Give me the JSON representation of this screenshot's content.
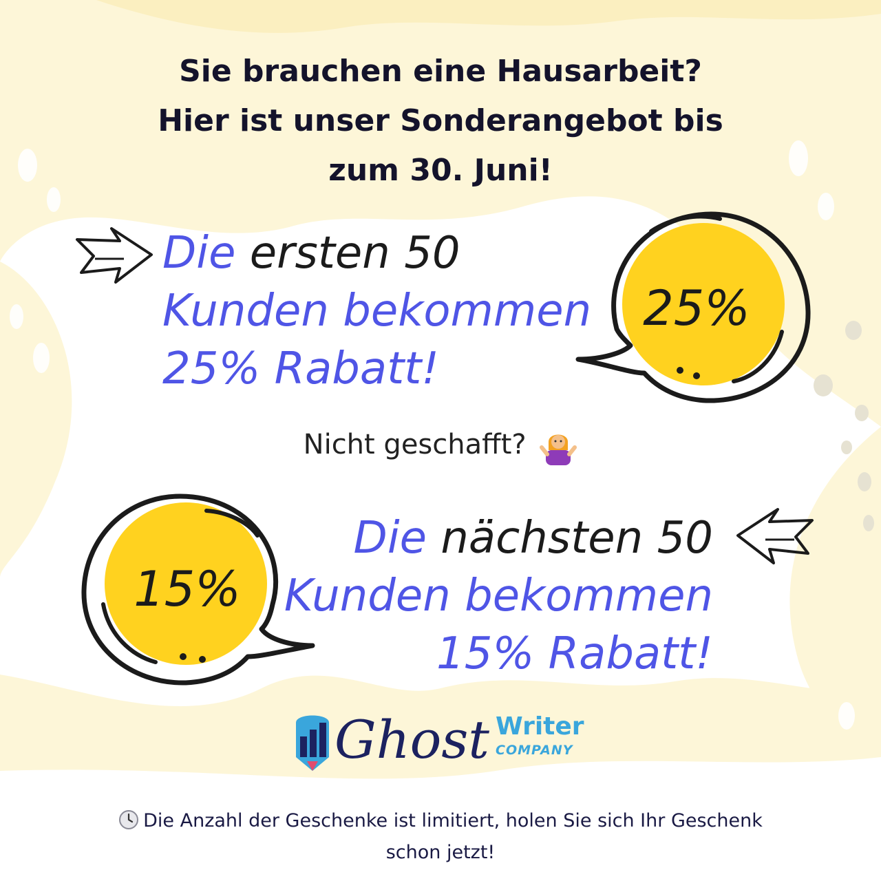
{
  "headline": {
    "line1": "Sie brauchen eine Hausarbeit?",
    "line2": "Hier ist unser Sonderangebot bis",
    "line3": "zum 30. Juni!"
  },
  "offer_first": {
    "word_blue": "Die",
    "word_dark": "ersten 50",
    "line2": "Kunden bekommen",
    "line3": "25% Rabatt!",
    "bubble_value": "25%"
  },
  "not_made": {
    "text": "Nicht geschafft?",
    "icon": "person-shrugging-icon"
  },
  "offer_next": {
    "word_blue": "Die",
    "word_dark": "nächsten 50",
    "line2": "Kunden bekommen",
    "line3": "15% Rabatt!",
    "bubble_value": "15%"
  },
  "logo": {
    "ghost": "Ghost",
    "writer": "Writer",
    "company": "COMPANY"
  },
  "footer": {
    "icon": "clock-icon",
    "line1": "Die Anzahl der Geschenke ist limitiert, holen Sie sich Ihr Geschenk",
    "line2": "schon jetzt!"
  },
  "colors": {
    "accent_blue": "#4f55e6",
    "bubble_yellow": "#ffd21f",
    "background_cream": "#fdf6d8",
    "logo_navy": "#1c2260",
    "logo_cyan": "#3aa6dc"
  }
}
